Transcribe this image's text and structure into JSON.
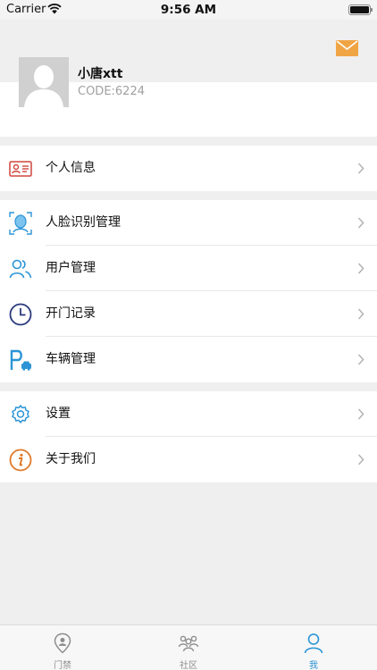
{
  "status_bar": {
    "carrier": "Carrier",
    "time": "9:56 AM"
  },
  "profile": {
    "name": "小唐xtt",
    "code": "CODE:6224"
  },
  "menu_groups": [
    [
      {
        "label": "个人信息",
        "icon": "id-card-icon",
        "color": "#d0453c"
      }
    ],
    [
      {
        "label": "人脸识别管理",
        "icon": "face-recognition-icon",
        "color": "#2b94d6"
      },
      {
        "label": "用户管理",
        "icon": "users-icon",
        "color": "#2b94d6"
      },
      {
        "label": "开门记录",
        "icon": "clock-icon",
        "color": "#2a3a7c"
      },
      {
        "label": "车辆管理",
        "icon": "parking-icon",
        "color": "#2b94d6"
      }
    ],
    [
      {
        "label": "设置",
        "icon": "gear-icon",
        "color": "#2b94d6"
      },
      {
        "label": "关于我们",
        "icon": "info-icon",
        "color": "#e07a2a"
      }
    ]
  ],
  "tabbar": {
    "tabs": [
      {
        "label": "门禁",
        "icon": "access-control-icon",
        "active": false
      },
      {
        "label": "社区",
        "icon": "community-icon",
        "active": false
      },
      {
        "label": "我",
        "icon": "person-icon",
        "active": true
      }
    ]
  },
  "colors": {
    "accent": "#2b94d6",
    "mail": "#f0a545",
    "background": "#efefef"
  }
}
